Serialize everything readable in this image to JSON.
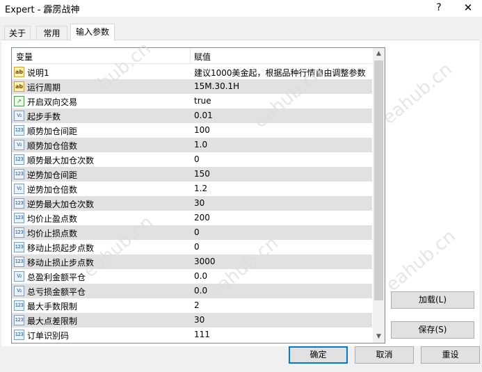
{
  "window": {
    "title": "Expert - 霹雳战神",
    "help": "?",
    "close": "✕"
  },
  "tabs": [
    {
      "label": "关于"
    },
    {
      "label": "常用"
    },
    {
      "label": "输入参数"
    }
  ],
  "grid": {
    "headers": {
      "variable": "变量",
      "value": "赋值"
    },
    "rows": [
      {
        "icon": "ab",
        "name": "说明1",
        "value": "建议1000美金起，根据品种行情自由调整参数"
      },
      {
        "icon": "ab",
        "name": "运行周期",
        "value": "15M.30.1H"
      },
      {
        "icon": "bool",
        "name": "开启双向交易",
        "value": "true"
      },
      {
        "icon": "double",
        "name": "起步手数",
        "value": "0.01"
      },
      {
        "icon": "int",
        "name": "顺势加仓间距",
        "value": "100"
      },
      {
        "icon": "double",
        "name": "顺势加仓倍数",
        "value": "1.0"
      },
      {
        "icon": "int",
        "name": "顺势最大加仓次数",
        "value": "0"
      },
      {
        "icon": "int",
        "name": "逆势加仓间距",
        "value": "150"
      },
      {
        "icon": "double",
        "name": "逆势加仓倍数",
        "value": "1.2"
      },
      {
        "icon": "int",
        "name": "逆势最大加仓次数",
        "value": "30"
      },
      {
        "icon": "int",
        "name": "均价止盈点数",
        "value": "200"
      },
      {
        "icon": "int",
        "name": "均价止损点数",
        "value": "0"
      },
      {
        "icon": "int",
        "name": "移动止损起步点数",
        "value": "0"
      },
      {
        "icon": "int",
        "name": "移动止损止步点数",
        "value": "3000"
      },
      {
        "icon": "double",
        "name": "总盈利金额平仓",
        "value": "0.0"
      },
      {
        "icon": "double",
        "name": "总亏损金额平仓",
        "value": "0.0"
      },
      {
        "icon": "int",
        "name": "最大手数限制",
        "value": "2"
      },
      {
        "icon": "int",
        "name": "最大点差限制",
        "value": "30"
      },
      {
        "icon": "int",
        "name": "订单识别码",
        "value": "111"
      }
    ],
    "icon_text": {
      "ab": "ab",
      "int": "123",
      "double": "V₂",
      "bool": "↗"
    }
  },
  "buttons": {
    "load": "加载(L)",
    "save": "保存(S)",
    "ok": "确定",
    "cancel": "取消",
    "reset": "重设"
  },
  "watermark": {
    "text_long": "eahub.cn",
    "text_short": "hub.cn"
  }
}
